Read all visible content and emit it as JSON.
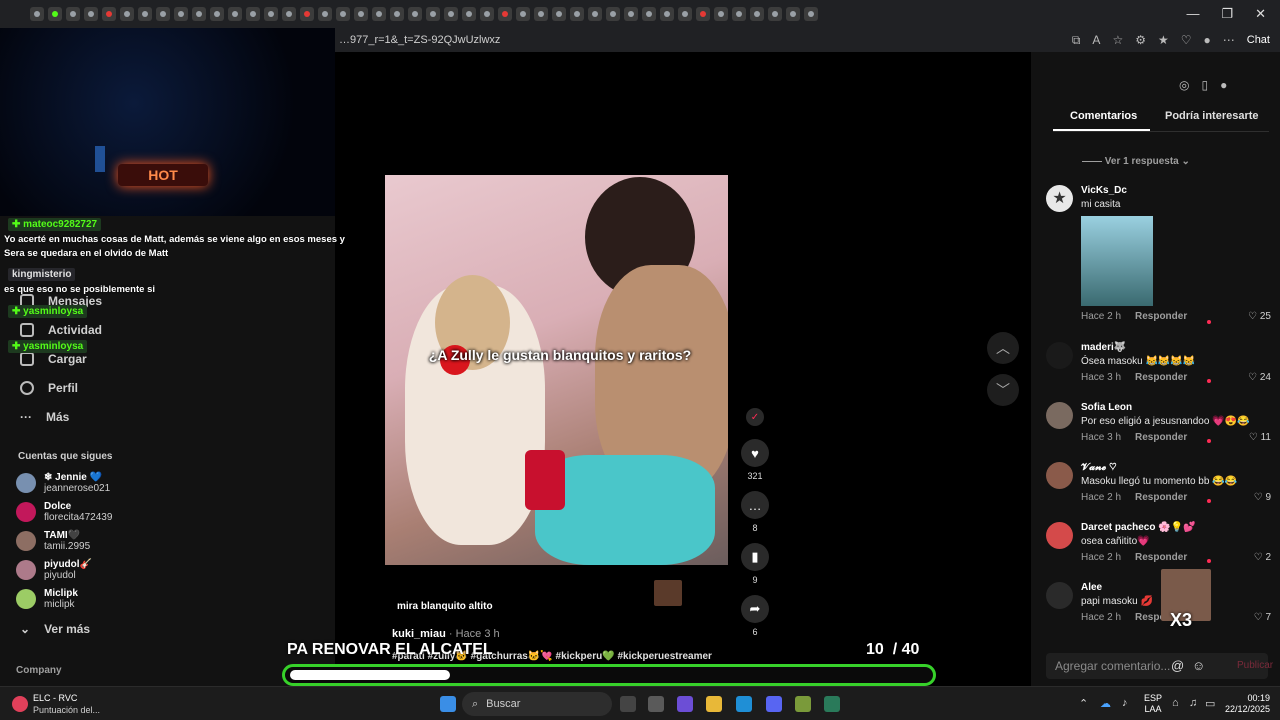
{
  "browser": {
    "url": "…977_r=1&_t=ZS-92QJwUzlwxz",
    "chat_label": "Chat"
  },
  "tiktok_nav": {
    "items": [
      "Mensajes",
      "Actividad",
      "Cargar",
      "Perfil",
      "Más"
    ],
    "following_title": "Cuentas que sigues",
    "following": [
      {
        "name": "❄ Jennie 💙",
        "handle": "jeannerose021"
      },
      {
        "name": "Dolce",
        "handle": "florecita472439"
      },
      {
        "name": "TAMI🖤",
        "handle": "tamii.2995"
      },
      {
        "name": "piyudol🎸",
        "handle": "piyudol"
      },
      {
        "name": "Miclipk",
        "handle": "miclipk"
      }
    ],
    "see_more": "Ver más",
    "company": "Company"
  },
  "kick_chat": [
    {
      "user": "mateoc9282727",
      "msg": "Yo acerté en muchas cosas de Matt, además se viene algo en esos meses y Sera se quedara en el olvido de Matt"
    },
    {
      "user": "kingmisterio",
      "msg": "es que eso no se posiblemente si"
    },
    {
      "user": "yasminloysa",
      "msg": ""
    },
    {
      "user": "yasminloysa",
      "msg": ""
    }
  ],
  "video": {
    "caption": "¿A Zully le gustan blanquitos y raritos?",
    "subtext": "mira blanquito altito",
    "author": "kuki_miau",
    "time": "· Hace 3 h",
    "hashtags": "#parati #zully🐱 #gatchurras🐱💘 #kickperu💚 #kickperuestreamer"
  },
  "actions": {
    "likes": "321",
    "comments": "8",
    "saves": "9",
    "shares": "6"
  },
  "comments_panel": {
    "tab_comments": "Comentarios",
    "tab_interesting": "Podría interesarte",
    "see_reply": "Ver 1 respuesta",
    "reply_label": "Responder",
    "add_placeholder": "Agregar comentario...",
    "post_label": "Publicar",
    "comments": [
      {
        "user": "VicKs_Dc",
        "text": "mi casita",
        "time": "Hace 2 h",
        "likes": "25"
      },
      {
        "user": "maderi🐺",
        "text": "Ósea masoku 😹😹😹😹",
        "time": "Hace 3 h",
        "likes": "24"
      },
      {
        "user": "Sofia Leon",
        "text": "Por eso eligió a jesusnandoo 💗😍😂",
        "time": "Hace 3 h",
        "likes": "11"
      },
      {
        "user": "𝓥𝓪𝓷𝓮 ♡",
        "text": "Masoku llegó tu momento bb 😂😂",
        "time": "Hace 2 h",
        "likes": "9"
      },
      {
        "user": "Darcet pacheco 🌸💡💕",
        "text": "osea cañitito💗",
        "time": "Hace 2 h",
        "likes": "2"
      },
      {
        "user": "Alee",
        "text": "papi masoku 💋",
        "time": "Hace 2 h",
        "likes": "7"
      }
    ]
  },
  "overlay": {
    "promo_text": "PA RENOVAR EL ALCATEL",
    "counter_current": "10",
    "counter_total": "/ 40",
    "progress": 0.25,
    "x3": "X3",
    "bar_color": "#37d12a"
  },
  "taskbar": {
    "notif_title": "ELC - RVC",
    "notif_sub": "Puntuación del...",
    "search": "Buscar",
    "lang1": "ESP",
    "lang2": "LAA",
    "time": "00:19",
    "date": "22/12/2025"
  }
}
